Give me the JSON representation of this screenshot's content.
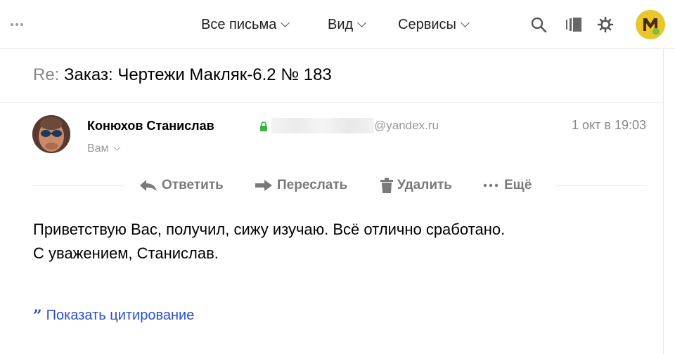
{
  "toolbar": {
    "more_icon": "more-dots-icon",
    "menu": [
      {
        "label": "Все письма"
      },
      {
        "label": "Вид"
      },
      {
        "label": "Сервисы"
      }
    ],
    "icons": [
      "search-icon",
      "compact-view-icon",
      "settings-gear-icon"
    ]
  },
  "message": {
    "subject_prefix": "Re:",
    "subject": "Заказ: Чертежи Макляк-6.2 № 183",
    "sender_name": "Конюхов Станислав",
    "sender_email_domain": "@yandex.ru",
    "date": "1 окт в 19:03",
    "recipient": "Вам",
    "body_lines": [
      "Приветствую Вас, получил, сижу изучаю. Всё отлично сработано.",
      "С уважением, Станислав."
    ],
    "show_quote_label": "Показать цитирование",
    "quote_mark": "”"
  },
  "actions": {
    "reply": "Ответить",
    "forward": "Переслать",
    "delete": "Удалить",
    "more": "Ещё"
  },
  "colors": {
    "accent_link": "#2a4fd6",
    "secure_lock": "#3cb043",
    "avatar_yellow": "#e9c62b"
  }
}
